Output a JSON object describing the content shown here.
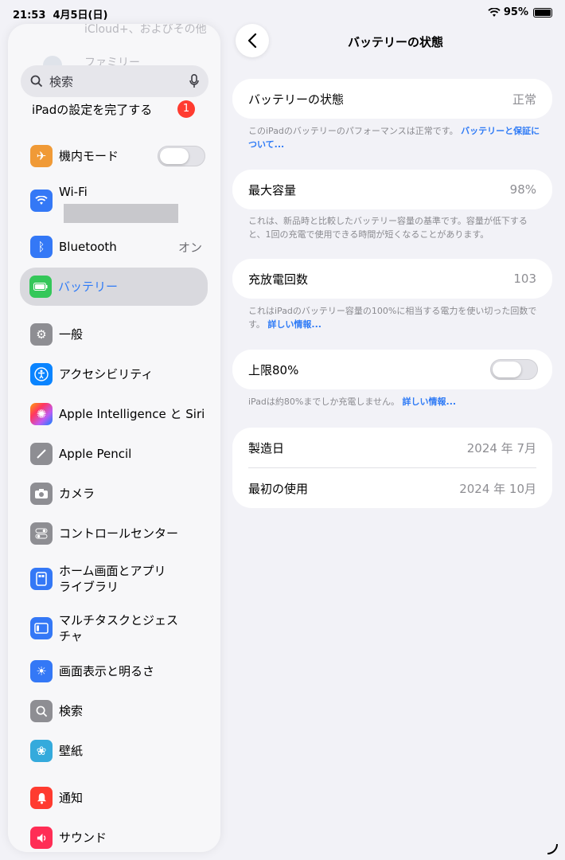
{
  "statusbar": {
    "time": "21:53",
    "date": "4月5日(日)",
    "battery": "95%"
  },
  "sidebar": {
    "ghost_top": "iCloud+、およびその他",
    "ghost_family": "ファミリー",
    "search_placeholder": "検索",
    "setup_label": "iPadの設定を完了する",
    "setup_badge": "1",
    "items": [
      {
        "label": "機内モード",
        "icon": "airplane-icon",
        "color": "#f09a37"
      },
      {
        "label": "Wi-Fi",
        "icon": "wifi-icon",
        "color": "#3478f6"
      },
      {
        "label": "Bluetooth",
        "value": "オン",
        "icon": "bluetooth-icon",
        "color": "#3478f6"
      },
      {
        "label": "バッテリー",
        "icon": "battery-icon",
        "color": "#34c759"
      },
      {
        "label": "一般",
        "icon": "gear-icon",
        "color": "#8e8e93"
      },
      {
        "label": "アクセシビリティ",
        "icon": "accessibility-icon",
        "color": "#0a84ff"
      },
      {
        "label": "Apple Intelligence と Siri",
        "icon": "siri-icon",
        "color": "#c45cf0"
      },
      {
        "label": "Apple Pencil",
        "icon": "pencil-icon",
        "color": "#8e8e93"
      },
      {
        "label": "カメラ",
        "icon": "camera-icon",
        "color": "#8e8e93"
      },
      {
        "label": "コントロールセンター",
        "icon": "toggles-icon",
        "color": "#8e8e93"
      },
      {
        "label_line1": "ホーム画面とアプリ",
        "label_line2": "ライブラリ",
        "icon": "home-screen-icon",
        "color": "#3478f6"
      },
      {
        "label_line1": "マルチタスクとジェス",
        "label_line2": "チャ",
        "icon": "multitask-icon",
        "color": "#3478f6"
      },
      {
        "label": "画面表示と明るさ",
        "icon": "sun-icon",
        "color": "#3478f6"
      },
      {
        "label": "検索",
        "icon": "search-icon",
        "color": "#8e8e93"
      },
      {
        "label": "壁紙",
        "icon": "flower-icon",
        "color": "#35aadc"
      },
      {
        "label": "通知",
        "icon": "bell-icon",
        "color": "#ff3b30"
      },
      {
        "label": "サウンド",
        "icon": "speaker-icon",
        "color": "#ff2d55"
      }
    ]
  },
  "detail": {
    "title": "バッテリーの状態",
    "health": {
      "label": "バッテリーの状態",
      "value": "正常",
      "note": "このiPadのバッテリーのパフォーマンスは正常です。",
      "note_link": "バッテリーと保証について..."
    },
    "capacity": {
      "label": "最大容量",
      "value": "98%",
      "note": "これは、新品時と比較したバッテリー容量の基準です。容量が低下すると、1回の充電で使用できる時間が短くなることがあります。"
    },
    "cycles": {
      "label": "充放電回数",
      "value": "103",
      "note": "これはiPadのバッテリー容量の100%に相当する電力を使い切った回数です。",
      "note_link": "詳しい情報..."
    },
    "limit": {
      "label": "上限80%",
      "note": "iPadは約80%までしか充電しません。",
      "note_link": "詳しい情報..."
    },
    "dates": {
      "manufactured_label": "製造日",
      "manufactured_value": "2024 年 7月",
      "first_use_label": "最初の使用",
      "first_use_value": "2024 年 10月"
    }
  }
}
